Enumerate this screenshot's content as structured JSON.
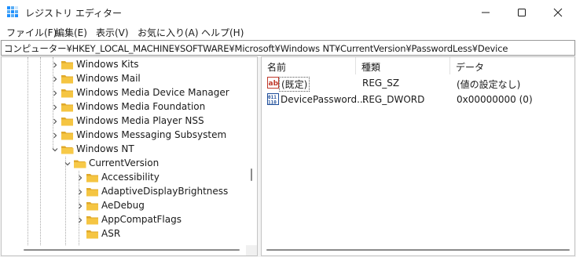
{
  "window": {
    "title": "レジストリ エディター"
  },
  "menu": {
    "items": [
      "ファイル(F)",
      "編集(E)",
      "表示(V)",
      "お気に入り(A)",
      "ヘルプ(H)"
    ]
  },
  "address": {
    "path": "コンピューター¥HKEY_LOCAL_MACHINE¥SOFTWARE¥Microsoft¥Windows NT¥CurrentVersion¥PasswordLess¥Device"
  },
  "tree": {
    "items": [
      {
        "label": "Windows Kits",
        "expanded": false
      },
      {
        "label": "Windows Mail",
        "expanded": false
      },
      {
        "label": "Windows Media Device Manager",
        "expanded": false
      },
      {
        "label": "Windows Media Foundation",
        "expanded": false
      },
      {
        "label": "Windows Media Player NSS",
        "expanded": false
      },
      {
        "label": "Windows Messaging Subsystem",
        "expanded": false
      },
      {
        "label": "Windows NT",
        "expanded": true
      },
      {
        "label": "CurrentVersion",
        "expanded": true
      },
      {
        "label": "Accessibility",
        "expanded": false
      },
      {
        "label": "AdaptiveDisplayBrightness",
        "expanded": false
      },
      {
        "label": "AeDebug",
        "expanded": false
      },
      {
        "label": "AppCompatFlags",
        "expanded": false
      },
      {
        "label": "ASR",
        "expanded": false
      }
    ]
  },
  "list": {
    "columns": [
      "名前",
      "種類",
      "データ"
    ],
    "rows": [
      {
        "name": "(既定)",
        "type": "REG_SZ",
        "data": "(値の設定なし)",
        "icon": "string-value-icon"
      },
      {
        "name": "DevicePassword...",
        "type": "REG_DWORD",
        "data": "0x00000000 (0)",
        "icon": "binary-value-icon"
      }
    ]
  },
  "colors": {
    "folder": "#f5c542",
    "accent": "#1e90ff",
    "string_icon": "#c0392b",
    "binary_icon": "#1f4e9a"
  }
}
